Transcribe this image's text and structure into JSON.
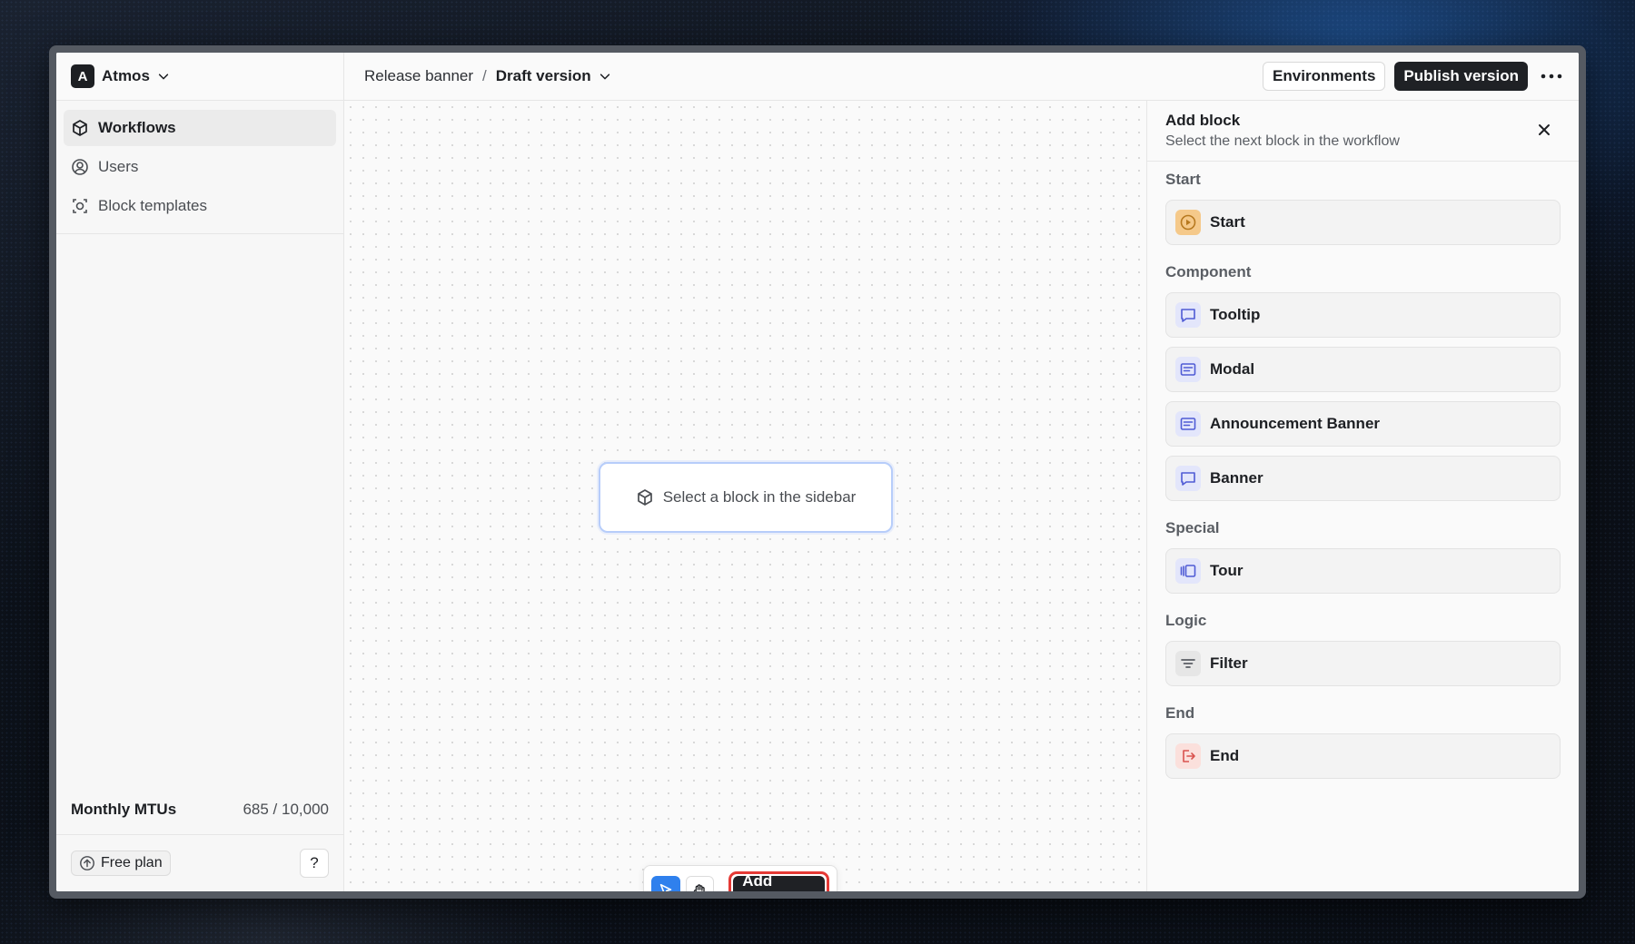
{
  "workspace": {
    "initial": "A",
    "name": "Atmos"
  },
  "sidebar": {
    "items": [
      {
        "label": "Workflows",
        "icon": "cube-icon",
        "active": true
      },
      {
        "label": "Users",
        "icon": "user-circle-icon"
      },
      {
        "label": "Block templates",
        "icon": "template-icon"
      }
    ],
    "mtu_label": "Monthly MTUs",
    "mtu_value": "685 / 10,000",
    "plan_label": "Free plan",
    "help_label": "?"
  },
  "topbar": {
    "crumb_parent": "Release banner",
    "crumb_separator": "/",
    "crumb_current": "Draft version",
    "environments_label": "Environments",
    "publish_label": "Publish version"
  },
  "canvas": {
    "placeholder": "Select a block in the sidebar",
    "add_block_label": "Add block"
  },
  "panel": {
    "title": "Add block",
    "subtitle": "Select the next block in the workflow",
    "sections": [
      {
        "label": "Start",
        "items": [
          {
            "label": "Start",
            "icon": "play-icon",
            "color": "#f5c98a",
            "stroke": "#b7791f"
          }
        ]
      },
      {
        "label": "Component",
        "items": [
          {
            "label": "Tooltip",
            "icon": "message-icon",
            "color": "#e3e6fb",
            "stroke": "#4f5bd5"
          },
          {
            "label": "Modal",
            "icon": "window-text-icon",
            "color": "#e3e6fb",
            "stroke": "#4f5bd5"
          },
          {
            "label": "Announcement Banner",
            "icon": "window-text-icon",
            "color": "#e3e6fb",
            "stroke": "#4f5bd5"
          },
          {
            "label": "Banner",
            "icon": "message-icon",
            "color": "#e3e6fb",
            "stroke": "#4f5bd5"
          }
        ]
      },
      {
        "label": "Special",
        "items": [
          {
            "label": "Tour",
            "icon": "carousel-icon",
            "color": "#e3e6fb",
            "stroke": "#4f5bd5"
          }
        ]
      },
      {
        "label": "Logic",
        "items": [
          {
            "label": "Filter",
            "icon": "filter-lines-icon",
            "color": "#e6e6e6",
            "stroke": "#5a5e64"
          }
        ]
      },
      {
        "label": "End",
        "items": [
          {
            "label": "End",
            "icon": "exit-icon",
            "color": "#fbe0dc",
            "stroke": "#d9534f"
          }
        ]
      }
    ]
  }
}
